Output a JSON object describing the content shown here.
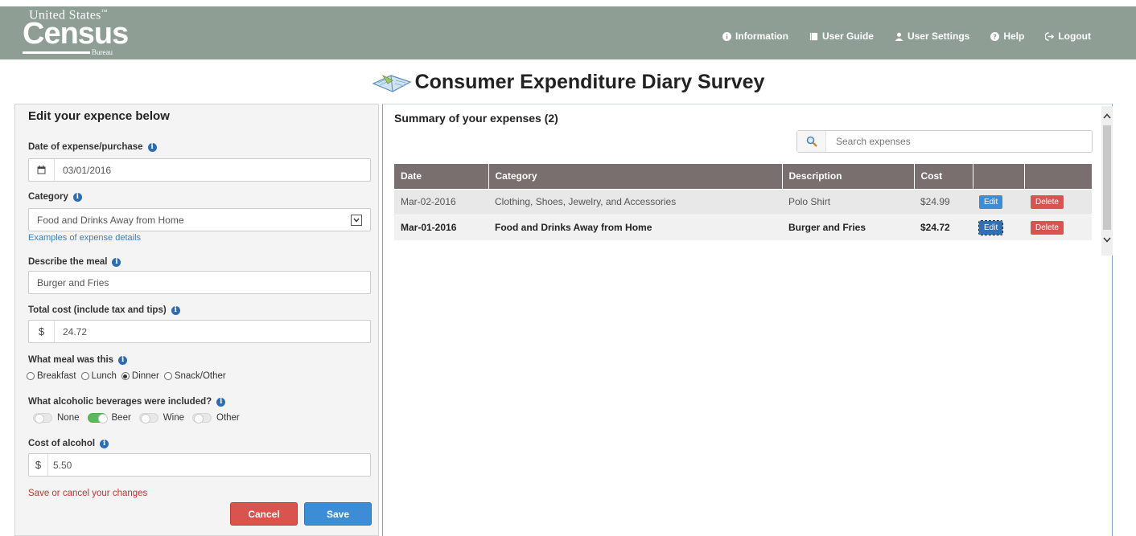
{
  "header": {
    "logo": {
      "top": "United States",
      "main": "Census",
      "sub": "Bureau"
    },
    "nav": [
      {
        "label": "Information",
        "icon": "info-circle-icon"
      },
      {
        "label": "User Guide",
        "icon": "book-icon"
      },
      {
        "label": "User Settings",
        "icon": "user-icon"
      },
      {
        "label": "Help",
        "icon": "question-circle-icon"
      },
      {
        "label": "Logout",
        "icon": "logout-icon"
      }
    ]
  },
  "title": "Consumer Expenditure Diary Survey",
  "edit": {
    "heading": "Edit your expence below",
    "date_label": "Date of expense/purchase",
    "date_value": "03/01/2016",
    "category_label": "Category",
    "category_value": "Food and Drinks Away from Home",
    "examples_link": "Examples of expense details",
    "describe_label": "Describe the meal",
    "describe_value": "Burger and Fries",
    "cost_label": "Total cost (include tax and tips)",
    "currency": "$",
    "cost_value": "24.72",
    "meal_label": "What meal was this",
    "meal_options": [
      "Breakfast",
      "Lunch",
      "Dinner",
      "Snack/Other"
    ],
    "meal_selected": "Dinner",
    "alcohol_label": "What alcoholic beverages were included?",
    "alcohol_options": [
      "None",
      "Beer",
      "Wine",
      "Other"
    ],
    "alcohol_selected": "Beer",
    "alcohol_cost_label": "Cost of alcohol",
    "alcohol_cost_value": "5.50",
    "save_note": "Save or cancel your changes",
    "cancel_label": "Cancel",
    "save_label": "Save"
  },
  "summary": {
    "title": "Summary of your expenses (2)",
    "search_placeholder": "Search expenses",
    "columns": [
      "Date",
      "Category",
      "Description",
      "Cost",
      "",
      ""
    ],
    "edit_label": "Edit",
    "delete_label": "Delete",
    "rows": [
      {
        "date": "Mar-02-2016",
        "category": "Clothing, Shoes, Jewelry, and Accessories",
        "description": "Polo Shirt",
        "cost": "$24.99"
      },
      {
        "date": "Mar-01-2016",
        "category": "Food and Drinks Away from Home",
        "description": "Burger and Fries",
        "cost": "$24.72"
      }
    ]
  },
  "colors": {
    "header_bg": "#8e9e94",
    "table_header": "#7a6f6f",
    "primary": "#3c8dd6",
    "danger": "#d9534f",
    "toggle_on": "#5cb85c"
  }
}
